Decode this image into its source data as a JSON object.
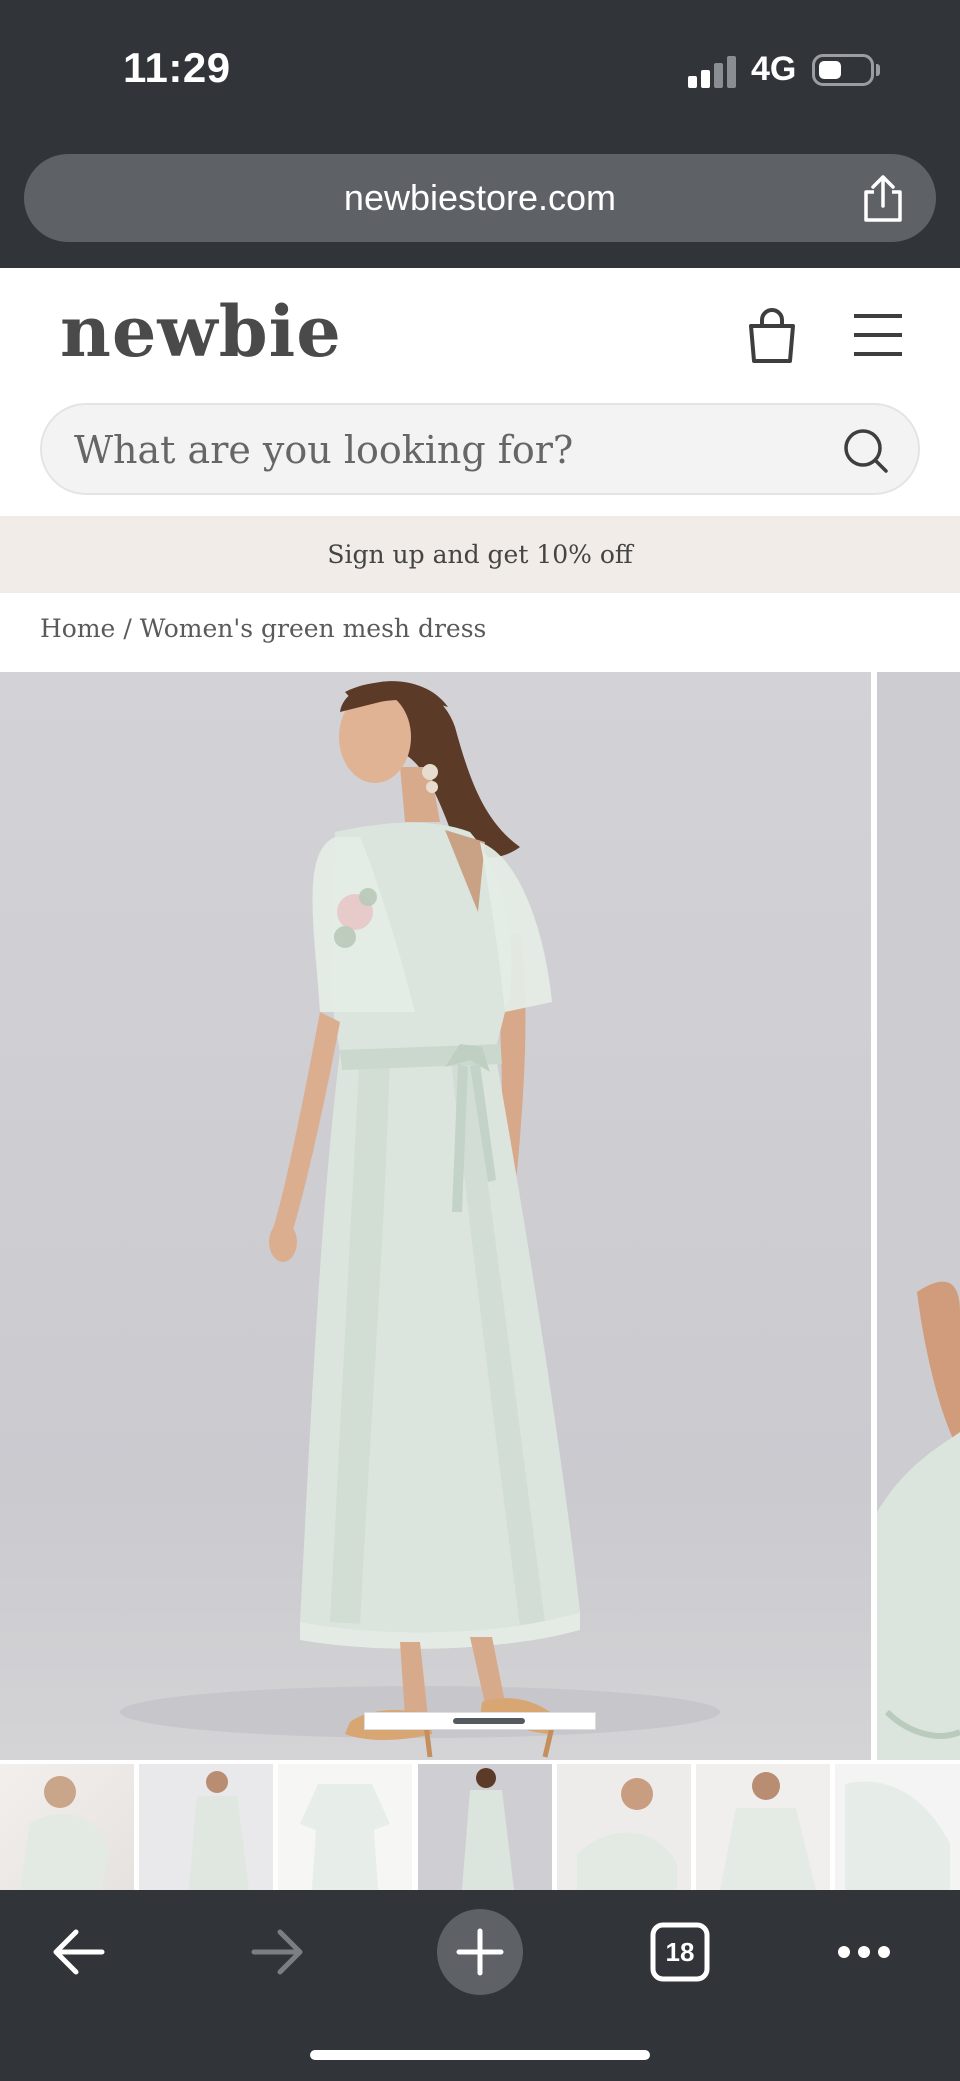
{
  "status_bar": {
    "time": "11:29",
    "network": "4G",
    "signal_bars_active": 2,
    "battery_level": 0.4
  },
  "browser": {
    "url": "newbiestore.com",
    "tab_count": "18",
    "icons": {
      "share": "share-icon",
      "back": "arrow-left-icon",
      "forward": "arrow-right-icon",
      "new_tab": "plus-icon",
      "tabs": "tabs-icon",
      "more": "more-dots-icon"
    }
  },
  "site": {
    "logo": "newbie",
    "search": {
      "placeholder": "What are you looking for?"
    },
    "promo": "Sign up and get 10% off",
    "breadcrumb": {
      "home": "Home",
      "separator": "/",
      "current": "Women's green mesh dress"
    },
    "icons": {
      "bag": "shopping-bag-icon",
      "menu": "hamburger-menu-icon",
      "search": "search-icon"
    }
  },
  "gallery": {
    "image_count": 7,
    "active_thumbnail": 4
  },
  "colors": {
    "chrome": "#313438",
    "url_bar": "#5e6266",
    "promo_bg": "#f1ece7",
    "dress": "#d9e4dc",
    "text": "#4a4a4a"
  }
}
